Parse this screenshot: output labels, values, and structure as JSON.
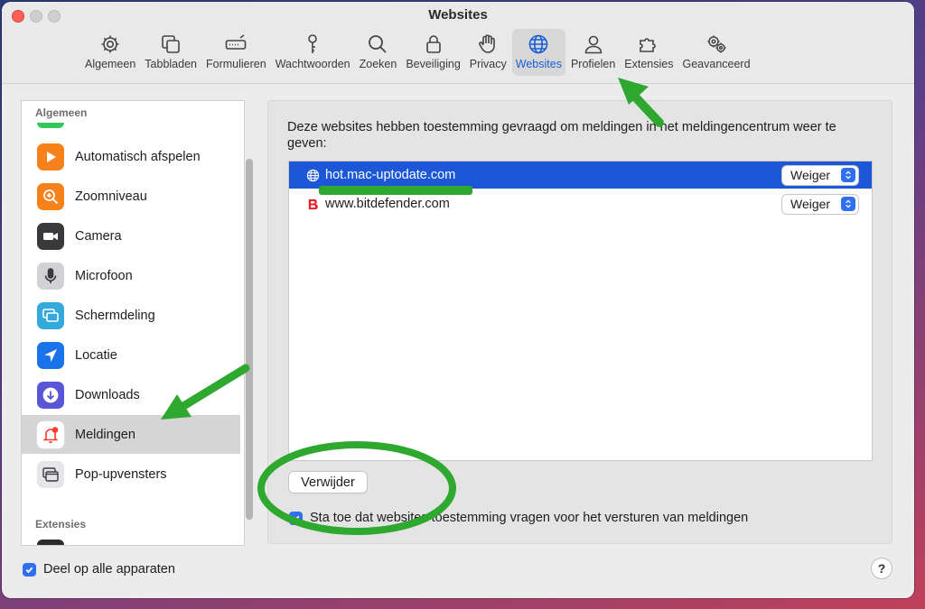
{
  "window": {
    "title": "Websites"
  },
  "toolbar": {
    "items": [
      {
        "label": "Algemeen",
        "icon": "gear-icon"
      },
      {
        "label": "Tabbladen",
        "icon": "tabs-icon"
      },
      {
        "label": "Formulieren",
        "icon": "form-icon"
      },
      {
        "label": "Wachtwoorden",
        "icon": "key-icon"
      },
      {
        "label": "Zoeken",
        "icon": "search-icon"
      },
      {
        "label": "Beveiliging",
        "icon": "lock-icon"
      },
      {
        "label": "Privacy",
        "icon": "hand-icon"
      },
      {
        "label": "Websites",
        "icon": "globe-icon",
        "active": true
      },
      {
        "label": "Profielen",
        "icon": "person-icon"
      },
      {
        "label": "Extensies",
        "icon": "puzzle-icon"
      },
      {
        "label": "Geavanceerd",
        "icon": "gears-icon"
      }
    ]
  },
  "sidebar": {
    "section_general": "Algemeen",
    "section_extensions": "Extensies",
    "items": [
      {
        "label": "Automatisch afspelen",
        "icon": "play-icon",
        "color": "#f7821b"
      },
      {
        "label": "Zoomniveau",
        "icon": "zoom-icon",
        "color": "#f7821b"
      },
      {
        "label": "Camera",
        "icon": "camera-icon",
        "color": "#3a3a3c"
      },
      {
        "label": "Microfoon",
        "icon": "microphone-icon",
        "color": "#8e8e93"
      },
      {
        "label": "Schermdeling",
        "icon": "screen-share-icon",
        "color": "#34aadc"
      },
      {
        "label": "Locatie",
        "icon": "location-icon",
        "color": "#1a73e8"
      },
      {
        "label": "Downloads",
        "icon": "download-icon",
        "color": "#5856d6"
      },
      {
        "label": "Meldingen",
        "icon": "bell-icon",
        "color": "#ff3b30",
        "selected": true
      },
      {
        "label": "Pop-upvensters",
        "icon": "popup-icon",
        "color": "#8e8e93"
      }
    ]
  },
  "main": {
    "description": "Deze websites hebben toestemming gevraagd om meldingen in het meldingencentrum weer te geven:",
    "websites": [
      {
        "site": "hot.mac-uptodate.com",
        "icon": "globe-icon",
        "permission": "Weiger",
        "selected": true
      },
      {
        "site": "www.bitdefender.com",
        "icon": "bitdefender-icon",
        "permission": "Weiger",
        "selected": false
      }
    ],
    "remove_button": "Verwijder",
    "allow_checkbox": "Sta toe dat websites toestemming vragen voor het versturen van meldingen"
  },
  "footer": {
    "share_checkbox": "Deel op alle apparaten",
    "help": "?"
  },
  "annotation_color": "#2fa82f",
  "accent_color": "#1b57d6"
}
